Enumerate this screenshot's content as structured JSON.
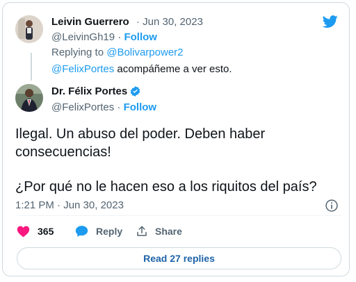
{
  "reply_tweet": {
    "author_name": "Leivin Guerrero",
    "separator": "·",
    "date": "Jun 30, 2023",
    "handle": "@LeivinGh19",
    "dot": "·",
    "follow_label": "Follow",
    "replying_prefix": "Replying to",
    "replying_to": "@Bolivarpower2",
    "mention": "@FelixPortes",
    "text": "acompáñeme a ver esto."
  },
  "main_tweet": {
    "author_name": "Dr. Félix Portes",
    "verified": true,
    "handle": "@FelixPortes",
    "dot": "·",
    "follow_label": "Follow",
    "text_line1": "Ilegal. Un abuso del poder. Deben haber",
    "text_line2": "consecuencias!",
    "text_line3": "¿Por qué no le hacen eso a los riquitos del país?",
    "timestamp": "1:21 PM · Jun 30, 2023"
  },
  "actions": {
    "like_count": "365",
    "reply_label": "Reply",
    "share_label": "Share",
    "read_replies_label": "Read 27 replies"
  },
  "colors": {
    "accent": "#1d9bf0",
    "like": "#f91880",
    "text": "#0f1419",
    "muted": "#536471"
  },
  "icons": {
    "brand": "twitter-bird-icon",
    "verified": "verified-badge-icon",
    "info": "info-icon",
    "like": "heart-icon",
    "reply": "speech-bubble-icon",
    "share": "share-upload-icon"
  }
}
